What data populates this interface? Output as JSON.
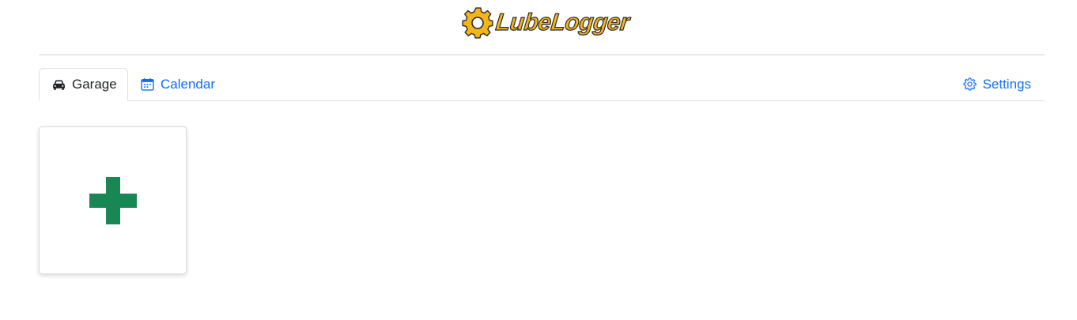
{
  "header": {
    "logo_text": "LubeLogger"
  },
  "tabs": [
    {
      "label": "Garage",
      "icon": "car-icon",
      "active": true
    },
    {
      "label": "Calendar",
      "icon": "calendar-icon",
      "active": false
    },
    {
      "label": "Settings",
      "icon": "gear-icon",
      "active": false
    }
  ],
  "garage": {
    "add_vehicle_icon": "plus-icon"
  },
  "colors": {
    "accent": "#0d6efd",
    "logo_yellow": "#f2b51a",
    "add_green": "#198754",
    "text": "#212529"
  }
}
